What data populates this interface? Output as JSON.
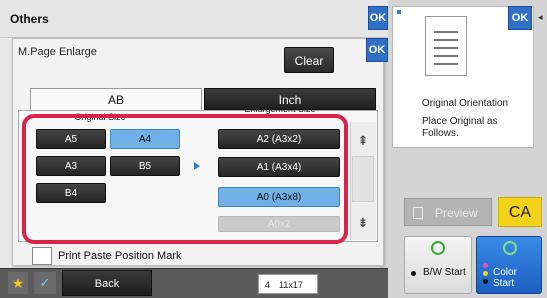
{
  "header": {
    "title": "Others",
    "ok_label": "OK"
  },
  "dialog": {
    "title": "M.Page Enlarge",
    "ok_label": "OK",
    "clear_label": "Clear",
    "tabs": [
      {
        "label": "AB",
        "selected": true
      },
      {
        "label": "Inch",
        "selected": false
      }
    ],
    "original_size_label": "Original Size",
    "enlargement_size_label": "Enlargement Size",
    "original_sizes": [
      "A5",
      "A4",
      "A3",
      "B5",
      "B4"
    ],
    "original_selected": "A4",
    "enlargement_sizes": [
      "A2 (A3x2)",
      "A1 (A3x4)",
      "A0 (A3x8)",
      "A0x2"
    ],
    "enlargement_selected": "A0 (A3x8)",
    "print_paste_label": "Print Paste Position Mark"
  },
  "right_panel": {
    "ok_label": "OK",
    "orientation_label": "Original Orientation",
    "orientation_note": "Place Original as Follows.",
    "preview_label": "Preview",
    "ca_label": "CA",
    "bw_start": "B/W Start",
    "color_start": "Color Start"
  },
  "bottom_bar": {
    "back_label": "Back",
    "paper_tray": "4",
    "paper_size": "11x17"
  },
  "colors": {
    "accent": "#2f6fc6",
    "selected": "#6fb1e6",
    "highlight": "#d8234b",
    "ca": "#f3d21a"
  }
}
